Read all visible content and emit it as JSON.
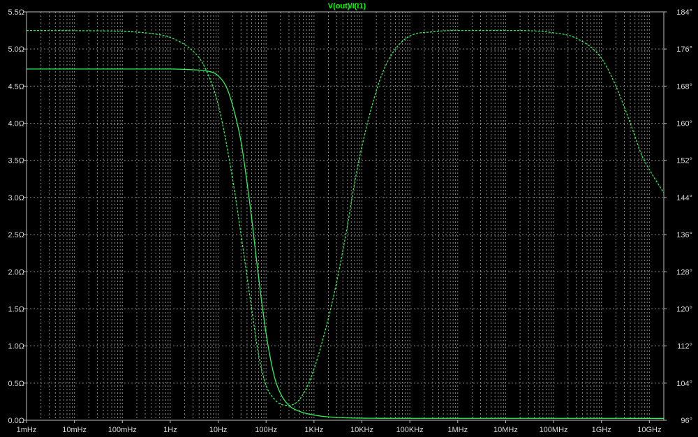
{
  "colors": {
    "background": "#000000",
    "frame": "#c0c0c0",
    "grid": "#8a8a8a",
    "text": "#d8d8d8",
    "trace": "#2ef05a",
    "title": "#00ff00"
  },
  "chart_data": {
    "type": "line",
    "title": "V(out)/I(I1)",
    "x_scale": "log",
    "x_unit": "Hz",
    "xlim": [
      0.001,
      20000000000
    ],
    "x_ticks": [
      {
        "value": 0.001,
        "label": "1mHz"
      },
      {
        "value": 0.01,
        "label": "10mHz"
      },
      {
        "value": 0.1,
        "label": "100mHz"
      },
      {
        "value": 1,
        "label": "1Hz"
      },
      {
        "value": 10,
        "label": "10Hz"
      },
      {
        "value": 100,
        "label": "100Hz"
      },
      {
        "value": 1000,
        "label": "1KHz"
      },
      {
        "value": 10000,
        "label": "10KHz"
      },
      {
        "value": 100000,
        "label": "100KHz"
      },
      {
        "value": 1000000,
        "label": "1MHz"
      },
      {
        "value": 10000000,
        "label": "10MHz"
      },
      {
        "value": 100000000,
        "label": "100MHz"
      },
      {
        "value": 1000000000,
        "label": "1GHz"
      },
      {
        "value": 10000000000,
        "label": "10GHz"
      }
    ],
    "ylim_left": [
      0,
      5.5
    ],
    "y_left_ticks": [
      {
        "value": 0.0,
        "label": "0.0Ω"
      },
      {
        "value": 0.5,
        "label": "0.5Ω"
      },
      {
        "value": 1.0,
        "label": "1.0Ω"
      },
      {
        "value": 1.5,
        "label": "1.5Ω"
      },
      {
        "value": 2.0,
        "label": "2.0Ω"
      },
      {
        "value": 2.5,
        "label": "2.5Ω"
      },
      {
        "value": 3.0,
        "label": "3.0Ω"
      },
      {
        "value": 3.5,
        "label": "3.5Ω"
      },
      {
        "value": 4.0,
        "label": "4.0Ω"
      },
      {
        "value": 4.5,
        "label": "4.5Ω"
      },
      {
        "value": 5.0,
        "label": "5.0Ω"
      },
      {
        "value": 5.5,
        "label": "5.5Ω"
      }
    ],
    "ylim_right": [
      96,
      184
    ],
    "y_right_ticks": [
      {
        "value": 96,
        "label": "96°"
      },
      {
        "value": 104,
        "label": "104°"
      },
      {
        "value": 112,
        "label": "112°"
      },
      {
        "value": 120,
        "label": "120°"
      },
      {
        "value": 128,
        "label": "128°"
      },
      {
        "value": 136,
        "label": "136°"
      },
      {
        "value": 144,
        "label": "144°"
      },
      {
        "value": 152,
        "label": "152°"
      },
      {
        "value": 160,
        "label": "160°"
      },
      {
        "value": 168,
        "label": "168°"
      },
      {
        "value": 176,
        "label": "176°"
      },
      {
        "value": 184,
        "label": "184°"
      }
    ],
    "grid": true,
    "series": [
      {
        "quantity": "magnitude",
        "axis": "left",
        "style": "solid",
        "points": [
          [
            0.001,
            4.73
          ],
          [
            1,
            4.73
          ],
          [
            3,
            4.72
          ],
          [
            5,
            4.71
          ],
          [
            8,
            4.68
          ],
          [
            10,
            4.64
          ],
          [
            15,
            4.48
          ],
          [
            20,
            4.24
          ],
          [
            30,
            3.75
          ],
          [
            40,
            3.2
          ],
          [
            50,
            2.72
          ],
          [
            60,
            2.28
          ],
          [
            70,
            1.92
          ],
          [
            80,
            1.62
          ],
          [
            100,
            1.17
          ],
          [
            120,
            0.87
          ],
          [
            150,
            0.58
          ],
          [
            200,
            0.36
          ],
          [
            300,
            0.2
          ],
          [
            500,
            0.12
          ],
          [
            1000,
            0.07
          ],
          [
            2000,
            0.045
          ],
          [
            5000,
            0.032
          ],
          [
            10000,
            0.028
          ],
          [
            100000,
            0.026
          ],
          [
            1000000000,
            0.026
          ],
          [
            20000000000,
            0.024
          ]
        ]
      },
      {
        "quantity": "phase",
        "axis": "right",
        "style": "dashed",
        "points": [
          [
            0.001,
            180
          ],
          [
            0.1,
            179.8
          ],
          [
            0.5,
            179.2
          ],
          [
            1,
            178.5
          ],
          [
            3,
            175.5
          ],
          [
            5,
            172.5
          ],
          [
            10,
            164
          ],
          [
            20,
            148
          ],
          [
            30,
            136
          ],
          [
            50,
            120
          ],
          [
            70,
            110
          ],
          [
            100,
            103.5
          ],
          [
            150,
            100.5
          ],
          [
            200,
            99.5
          ],
          [
            300,
            99.2
          ],
          [
            400,
            99.6
          ],
          [
            500,
            100.5
          ],
          [
            700,
            103
          ],
          [
            1000,
            107
          ],
          [
            2000,
            118
          ],
          [
            3000,
            126
          ],
          [
            5000,
            138
          ],
          [
            7000,
            147
          ],
          [
            10000,
            155
          ],
          [
            20000,
            167
          ],
          [
            30000,
            172
          ],
          [
            50000,
            176
          ],
          [
            100000,
            178.8
          ],
          [
            300000,
            179.7
          ],
          [
            1000000,
            180
          ],
          [
            10000000,
            180
          ],
          [
            100000000,
            179.5
          ],
          [
            300000000,
            178.3
          ],
          [
            1000000000,
            174
          ],
          [
            2000000000,
            168
          ],
          [
            4000000000,
            160
          ],
          [
            7000000000,
            153
          ],
          [
            10000000000,
            150
          ],
          [
            20000000000,
            145
          ]
        ]
      }
    ]
  }
}
